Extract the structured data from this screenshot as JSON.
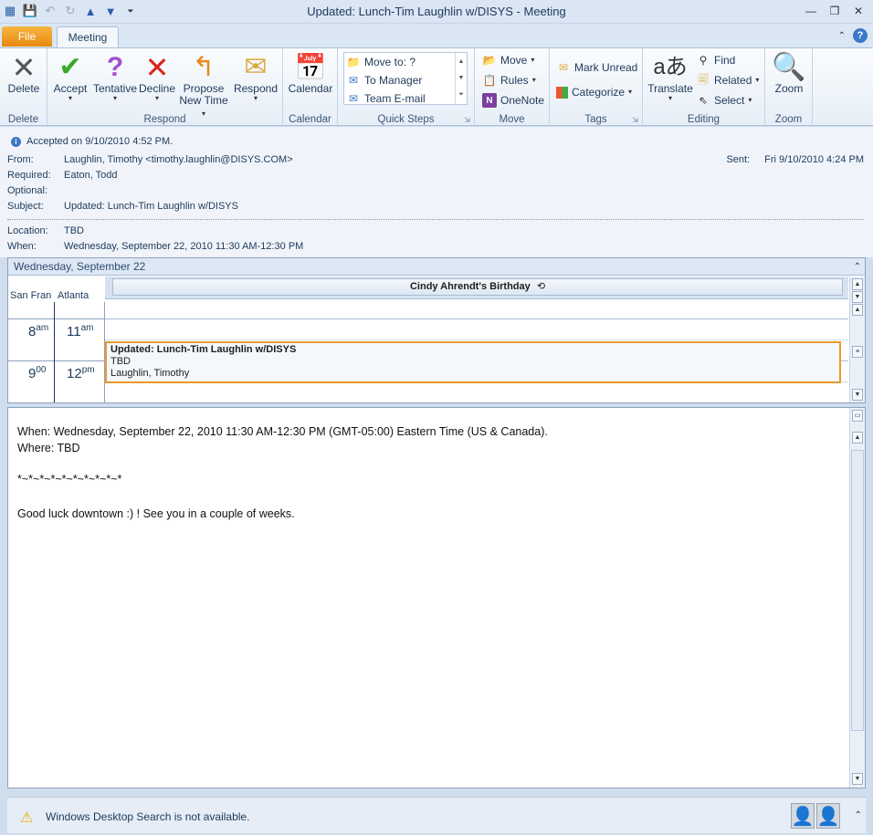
{
  "window": {
    "title": "Updated: Lunch-Tim Laughlin w/DISYS  -  Meeting"
  },
  "tabs": {
    "file": "File",
    "meeting": "Meeting"
  },
  "ribbon": {
    "delete": {
      "button": "Delete",
      "group": "Delete"
    },
    "respond": {
      "accept": "Accept",
      "tentative": "Tentative",
      "decline": "Decline",
      "propose_line1": "Propose",
      "propose_line2": "New Time",
      "respond": "Respond",
      "group": "Respond"
    },
    "calendar": {
      "button": "Calendar",
      "group": "Calendar"
    },
    "quick_steps": {
      "items": [
        "Move to: ?",
        "To Manager",
        "Team E-mail"
      ],
      "group": "Quick Steps"
    },
    "move": {
      "move": "Move",
      "rules": "Rules",
      "onenote": "OneNote",
      "group": "Move"
    },
    "tags": {
      "mark_unread": "Mark Unread",
      "categorize": "Categorize",
      "group": "Tags"
    },
    "editing": {
      "translate": "Translate",
      "find": "Find",
      "related": "Related",
      "select": "Select",
      "group": "Editing"
    },
    "zoom": {
      "button": "Zoom",
      "group": "Zoom"
    }
  },
  "header": {
    "accepted": "Accepted on 9/10/2010 4:52 PM.",
    "from_label": "From:",
    "from": "Laughlin, Timothy <timothy.laughlin@DISYS.COM>",
    "required_label": "Required:",
    "required": "Eaton, Todd",
    "optional_label": "Optional:",
    "optional": "",
    "subject_label": "Subject:",
    "subject": "Updated: Lunch-Tim Laughlin w/DISYS",
    "sent_label": "Sent:",
    "sent": "Fri 9/10/2010 4:24 PM",
    "location_label": "Location:",
    "location": "TBD",
    "when_label": "When:",
    "when": "Wednesday, September 22, 2010 11:30 AM-12:30 PM"
  },
  "calendar": {
    "date_header": "Wednesday, September 22",
    "timezones": [
      "San Fran",
      "Atlanta"
    ],
    "all_day_event": "Cindy Ahrendt's Birthday",
    "hours": [
      {
        "left": "8",
        "left_suffix": "am",
        "right": "11",
        "right_suffix": "am"
      },
      {
        "left": "9",
        "left_suffix": "00",
        "right": "12",
        "right_suffix": "pm"
      }
    ],
    "appointment": {
      "title": "Updated: Lunch-Tim Laughlin w/DISYS",
      "location": "TBD",
      "organizer": "Laughlin, Timothy"
    }
  },
  "body": {
    "when_line": "When: Wednesday, September 22, 2010 11:30 AM-12:30 PM (GMT-05:00) Eastern Time (US & Canada).",
    "where_line": "Where: TBD",
    "separator": "*~*~*~*~*~*~*~*~*~*",
    "message": "Good luck downtown :) !  See you in a couple of weeks."
  },
  "status": {
    "message": "Windows Desktop Search is not available."
  }
}
